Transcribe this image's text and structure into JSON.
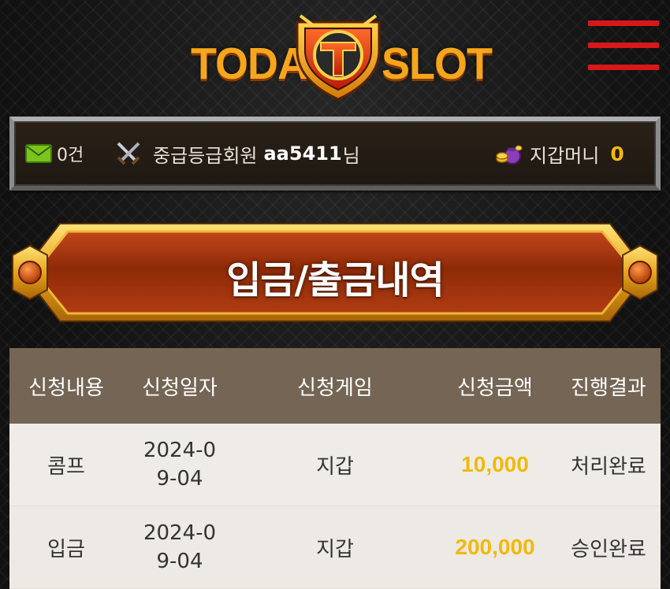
{
  "brand": {
    "word_left": "TODAY",
    "word_right": "SLOT",
    "colors": {
      "gold": "#f5a61c",
      "red": "#d8181a",
      "emblem_red": "#e03a17"
    }
  },
  "header": {
    "menu_icon": "hamburger-menu-icon"
  },
  "user_bar": {
    "mail_icon": "mail-icon",
    "mail_count": "0건",
    "rank_icon": "crossed-swords-icon",
    "grade_label": "중급등급회원",
    "username": "aa5411",
    "honorific": "님",
    "wallet_icon": "coin-pouch-icon",
    "wallet_label": "지갑머니",
    "wallet_amount": "0"
  },
  "page": {
    "title": "입금/출금내역"
  },
  "table": {
    "headers": [
      "신청내용",
      "신청일자",
      "신청게임",
      "신청금액",
      "진행결과"
    ],
    "rows": [
      {
        "type": "콤프",
        "date": "2024-09-04",
        "game": "지갑",
        "amount": "10,000",
        "result": "처리완료"
      },
      {
        "type": "입금",
        "date": "2024-09-04",
        "game": "지갑",
        "amount": "200,000",
        "result": "승인완료"
      }
    ],
    "colors": {
      "header_bg": "#746555",
      "amount": "#f2b90a"
    }
  }
}
